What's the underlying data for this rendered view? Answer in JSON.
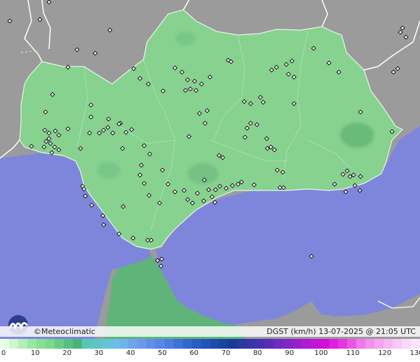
{
  "map": {
    "brand": "©Meteoclimatic",
    "caption": "DGST (km/h)   13-07-2025 @ 21:05 UTC",
    "colors": {
      "sea": "#7e86dc",
      "land_outside": "#9a9a9a",
      "region": "#86d28e",
      "borders": "#ffffff"
    }
  },
  "legend": {
    "ticks": [
      "0",
      "10",
      "20",
      "30",
      "40",
      "50",
      "60",
      "70",
      "80",
      "90",
      "100",
      "110",
      "120",
      "130"
    ],
    "colors": [
      "#e8ffe8",
      "#ccf7cf",
      "#b2f0b7",
      "#98e9a0",
      "#86e08f",
      "#7ad98a",
      "#68cc86",
      "#58c07e",
      "#4ab476",
      "#56c8b4",
      "#5cc6c6",
      "#64c4d4",
      "#6cbde6",
      "#6fb2ec",
      "#6ea4ee",
      "#6d98ee",
      "#5f8eea",
      "#5686e6",
      "#4b7ce2",
      "#3f72d8",
      "#3567cc",
      "#2b5ec4",
      "#2255bc",
      "#1d4cae",
      "#1a44a2",
      "#173c98",
      "#2a3aa0",
      "#3636a8",
      "#4232b0",
      "#5a2cb6",
      "#6e2cbe",
      "#8226c6",
      "#9820cc",
      "#ae1ad2",
      "#c414d8",
      "#d20ed8",
      "#dc20dc",
      "#e436e0",
      "#ea56e4",
      "#ef78ea",
      "#f290ee",
      "#f5a4f0",
      "#f7b6f3",
      "#f9c8f5",
      "#fbd8f8",
      "#fde6fb"
    ]
  },
  "stations": [
    [
      14,
      30
    ],
    [
      57,
      28
    ],
    [
      70,
      3
    ],
    [
      157,
      43
    ],
    [
      110,
      71
    ],
    [
      136,
      76
    ],
    [
      97,
      96
    ],
    [
      191,
      98
    ],
    [
      200,
      112
    ],
    [
      212,
      120
    ],
    [
      250,
      97
    ],
    [
      260,
      103
    ],
    [
      268,
      114
    ],
    [
      272,
      127
    ],
    [
      278,
      116
    ],
    [
      288,
      120
    ],
    [
      265,
      129
    ],
    [
      280,
      129
    ],
    [
      300,
      110
    ],
    [
      326,
      86
    ],
    [
      330,
      88
    ],
    [
      388,
      100
    ],
    [
      395,
      96
    ],
    [
      409,
      92
    ],
    [
      417,
      87
    ],
    [
      420,
      110
    ],
    [
      412,
      106
    ],
    [
      420,
      148
    ],
    [
      448,
      69
    ],
    [
      470,
      90
    ],
    [
      484,
      103
    ],
    [
      515,
      160
    ],
    [
      560,
      188
    ],
    [
      562,
      103
    ],
    [
      568,
      98
    ],
    [
      575,
      40
    ],
    [
      572,
      46
    ],
    [
      580,
      53
    ],
    [
      233,
      130
    ],
    [
      130,
      150
    ],
    [
      130,
      167
    ],
    [
      75,
      135
    ],
    [
      65,
      160
    ],
    [
      64,
      186
    ],
    [
      70,
      190
    ],
    [
      79,
      187
    ],
    [
      97,
      184
    ],
    [
      84,
      193
    ],
    [
      70,
      198
    ],
    [
      66,
      202
    ],
    [
      72,
      205
    ],
    [
      78,
      210
    ],
    [
      84,
      214
    ],
    [
      74,
      218
    ],
    [
      63,
      210
    ],
    [
      45,
      209
    ],
    [
      115,
      212
    ],
    [
      128,
      190
    ],
    [
      142,
      190
    ],
    [
      148,
      186
    ],
    [
      154,
      182
    ],
    [
      161,
      190
    ],
    [
      172,
      176
    ],
    [
      175,
      212
    ],
    [
      188,
      185
    ],
    [
      155,
      170
    ],
    [
      170,
      177
    ],
    [
      180,
      189
    ],
    [
      206,
      208
    ],
    [
      214,
      220
    ],
    [
      202,
      236
    ],
    [
      232,
      243
    ],
    [
      240,
      263
    ],
    [
      250,
      274
    ],
    [
      263,
      272
    ],
    [
      268,
      285
    ],
    [
      275,
      290
    ],
    [
      282,
      276
    ],
    [
      298,
      271
    ],
    [
      308,
      271
    ],
    [
      314,
      266
    ],
    [
      323,
      269
    ],
    [
      332,
      265
    ],
    [
      340,
      263
    ],
    [
      345,
      260
    ],
    [
      363,
      264
    ],
    [
      292,
      257
    ],
    [
      291,
      287
    ],
    [
      303,
      281
    ],
    [
      307,
      289
    ],
    [
      270,
      195
    ],
    [
      313,
      222
    ],
    [
      318,
      225
    ],
    [
      296,
      158
    ],
    [
      293,
      176
    ],
    [
      285,
      162
    ],
    [
      349,
      145
    ],
    [
      353,
      183
    ],
    [
      350,
      196
    ],
    [
      358,
      176
    ],
    [
      367,
      178
    ],
    [
      381,
      198
    ],
    [
      382,
      212
    ],
    [
      387,
      210
    ],
    [
      392,
      214
    ],
    [
      396,
      243
    ],
    [
      404,
      246
    ],
    [
      405,
      268
    ],
    [
      400,
      268
    ],
    [
      478,
      263
    ],
    [
      490,
      249
    ],
    [
      496,
      244
    ],
    [
      500,
      252
    ],
    [
      505,
      250
    ],
    [
      515,
      252
    ],
    [
      507,
      265
    ],
    [
      514,
      272
    ],
    [
      494,
      274
    ],
    [
      200,
      250
    ],
    [
      213,
      279
    ],
    [
      206,
      262
    ],
    [
      228,
      290
    ],
    [
      176,
      295
    ],
    [
      147,
      308
    ],
    [
      148,
      321
    ],
    [
      170,
      334
    ],
    [
      190,
      340
    ],
    [
      211,
      343
    ],
    [
      216,
      343
    ],
    [
      118,
      266
    ],
    [
      120,
      270
    ],
    [
      122,
      280
    ],
    [
      131,
      293
    ],
    [
      225,
      372
    ],
    [
      231,
      370
    ],
    [
      230,
      380
    ],
    [
      445,
      366
    ],
    [
      376,
      146
    ],
    [
      372,
      139
    ],
    [
      358,
      148
    ]
  ]
}
